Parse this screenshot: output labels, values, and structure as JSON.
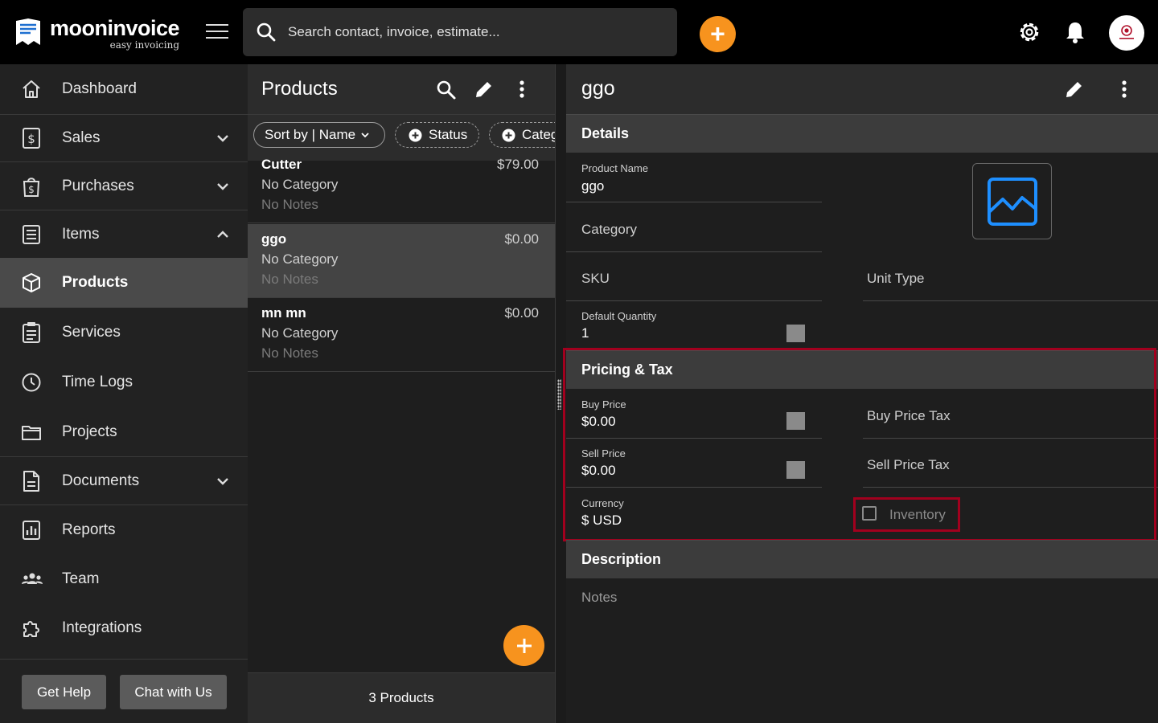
{
  "app": {
    "brand_name": "mooninvoice",
    "brand_tagline": "easy invoicing",
    "accent_color": "#f7931e",
    "highlight_color": "#a2001e"
  },
  "topbar": {
    "search_placeholder": "Search contact, invoice, estimate...",
    "add_button": "+"
  },
  "sidebar": {
    "items": [
      {
        "label": "Dashboard",
        "icon": "home-icon"
      },
      {
        "label": "Sales",
        "icon": "dollar-doc-icon",
        "expandable": true,
        "expanded": false
      },
      {
        "label": "Purchases",
        "icon": "bag-dollar-icon",
        "expandable": true,
        "expanded": false
      },
      {
        "label": "Items",
        "icon": "list-icon",
        "expandable": true,
        "expanded": true
      },
      {
        "label": "Products",
        "icon": "box-icon",
        "active": true
      },
      {
        "label": "Services",
        "icon": "clipboard-icon"
      },
      {
        "label": "Time Logs",
        "icon": "clock-icon"
      },
      {
        "label": "Projects",
        "icon": "folder-icon"
      },
      {
        "label": "Documents",
        "icon": "document-icon",
        "expandable": true,
        "expanded": false
      },
      {
        "label": "Reports",
        "icon": "bar-chart-icon"
      },
      {
        "label": "Team",
        "icon": "team-icon"
      },
      {
        "label": "Integrations",
        "icon": "puzzle-icon"
      }
    ],
    "help_button": "Get Help",
    "chat_button": "Chat with Us"
  },
  "products_list": {
    "title": "Products",
    "filters": {
      "sort": "Sort by | Name",
      "status": "Status",
      "category": "Category"
    },
    "products": [
      {
        "name": "Cutter",
        "price": "$79.00",
        "category": "No Category",
        "notes": "No Notes",
        "selected": false
      },
      {
        "name": "ggo",
        "price": "$0.00",
        "category": "No Category",
        "notes": "No Notes",
        "selected": true
      },
      {
        "name": "mn mn",
        "price": "$0.00",
        "category": "No Category",
        "notes": "No Notes",
        "selected": false
      }
    ],
    "footer_count": "3 Products"
  },
  "detail": {
    "title": "ggo",
    "details_section": "Details",
    "product_name_label": "Product Name",
    "product_name_value": "ggo",
    "category_placeholder": "Category",
    "sku_placeholder": "SKU",
    "unit_type_placeholder": "Unit Type",
    "default_quantity_label": "Default Quantity",
    "default_quantity_value": "1",
    "pricing_section": "Pricing & Tax",
    "buy_price_label": "Buy Price",
    "buy_price_value": "$0.00",
    "buy_price_tax_placeholder": "Buy Price Tax",
    "sell_price_label": "Sell Price",
    "sell_price_value": "$0.00",
    "sell_price_tax_placeholder": "Sell Price Tax",
    "currency_label": "Currency",
    "currency_value": "$ USD",
    "inventory_label": "Inventory",
    "inventory_checked": false,
    "description_section": "Description",
    "notes_placeholder": "Notes"
  }
}
